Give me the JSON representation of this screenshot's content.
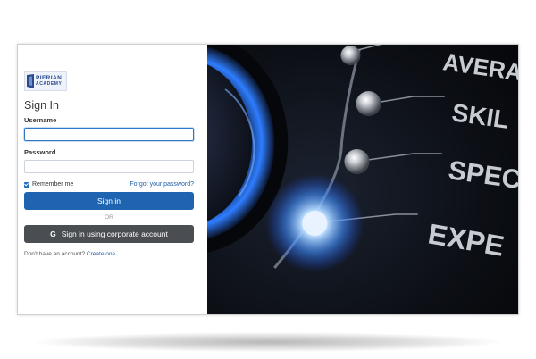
{
  "logo": {
    "line1": "PIERIAN",
    "line2": "ACADEMY"
  },
  "form": {
    "title": "Sign In",
    "username_label": "Username",
    "username_value": "",
    "password_label": "Password",
    "password_value": "",
    "remember_label": "Remember me",
    "remember_checked": true,
    "forgot_link": "Forgot your password?",
    "sign_in_button": "Sign in",
    "or_text": "OR",
    "corporate_button": "Sign in using corporate account",
    "no_account_text": "Don't have an account?",
    "create_link": "Create one"
  },
  "image": {
    "scale_words": [
      "AVERA",
      "SKIL",
      "SPEC",
      "EXPE"
    ]
  },
  "colors": {
    "primary": "#1e64b0",
    "corporate": "#4a4d52",
    "link": "#1f5fa8"
  },
  "icons": {
    "corporate": "g-letter-icon",
    "checkbox": "checkmark-icon"
  }
}
